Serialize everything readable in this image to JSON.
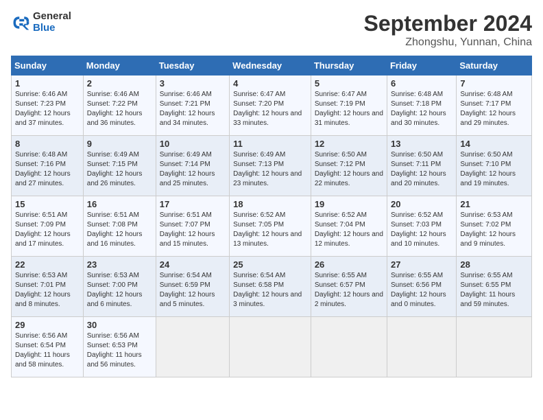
{
  "logo": {
    "general": "General",
    "blue": "Blue"
  },
  "title": "September 2024",
  "location": "Zhongshu, Yunnan, China",
  "days_header": [
    "Sunday",
    "Monday",
    "Tuesday",
    "Wednesday",
    "Thursday",
    "Friday",
    "Saturday"
  ],
  "weeks": [
    [
      {
        "day": "1",
        "sunrise": "6:46 AM",
        "sunset": "7:23 PM",
        "daylight": "12 hours and 37 minutes."
      },
      {
        "day": "2",
        "sunrise": "6:46 AM",
        "sunset": "7:22 PM",
        "daylight": "12 hours and 36 minutes."
      },
      {
        "day": "3",
        "sunrise": "6:46 AM",
        "sunset": "7:21 PM",
        "daylight": "12 hours and 34 minutes."
      },
      {
        "day": "4",
        "sunrise": "6:47 AM",
        "sunset": "7:20 PM",
        "daylight": "12 hours and 33 minutes."
      },
      {
        "day": "5",
        "sunrise": "6:47 AM",
        "sunset": "7:19 PM",
        "daylight": "12 hours and 31 minutes."
      },
      {
        "day": "6",
        "sunrise": "6:48 AM",
        "sunset": "7:18 PM",
        "daylight": "12 hours and 30 minutes."
      },
      {
        "day": "7",
        "sunrise": "6:48 AM",
        "sunset": "7:17 PM",
        "daylight": "12 hours and 29 minutes."
      }
    ],
    [
      {
        "day": "8",
        "sunrise": "6:48 AM",
        "sunset": "7:16 PM",
        "daylight": "12 hours and 27 minutes."
      },
      {
        "day": "9",
        "sunrise": "6:49 AM",
        "sunset": "7:15 PM",
        "daylight": "12 hours and 26 minutes."
      },
      {
        "day": "10",
        "sunrise": "6:49 AM",
        "sunset": "7:14 PM",
        "daylight": "12 hours and 25 minutes."
      },
      {
        "day": "11",
        "sunrise": "6:49 AM",
        "sunset": "7:13 PM",
        "daylight": "12 hours and 23 minutes."
      },
      {
        "day": "12",
        "sunrise": "6:50 AM",
        "sunset": "7:12 PM",
        "daylight": "12 hours and 22 minutes."
      },
      {
        "day": "13",
        "sunrise": "6:50 AM",
        "sunset": "7:11 PM",
        "daylight": "12 hours and 20 minutes."
      },
      {
        "day": "14",
        "sunrise": "6:50 AM",
        "sunset": "7:10 PM",
        "daylight": "12 hours and 19 minutes."
      }
    ],
    [
      {
        "day": "15",
        "sunrise": "6:51 AM",
        "sunset": "7:09 PM",
        "daylight": "12 hours and 17 minutes."
      },
      {
        "day": "16",
        "sunrise": "6:51 AM",
        "sunset": "7:08 PM",
        "daylight": "12 hours and 16 minutes."
      },
      {
        "day": "17",
        "sunrise": "6:51 AM",
        "sunset": "7:07 PM",
        "daylight": "12 hours and 15 minutes."
      },
      {
        "day": "18",
        "sunrise": "6:52 AM",
        "sunset": "7:05 PM",
        "daylight": "12 hours and 13 minutes."
      },
      {
        "day": "19",
        "sunrise": "6:52 AM",
        "sunset": "7:04 PM",
        "daylight": "12 hours and 12 minutes."
      },
      {
        "day": "20",
        "sunrise": "6:52 AM",
        "sunset": "7:03 PM",
        "daylight": "12 hours and 10 minutes."
      },
      {
        "day": "21",
        "sunrise": "6:53 AM",
        "sunset": "7:02 PM",
        "daylight": "12 hours and 9 minutes."
      }
    ],
    [
      {
        "day": "22",
        "sunrise": "6:53 AM",
        "sunset": "7:01 PM",
        "daylight": "12 hours and 8 minutes."
      },
      {
        "day": "23",
        "sunrise": "6:53 AM",
        "sunset": "7:00 PM",
        "daylight": "12 hours and 6 minutes."
      },
      {
        "day": "24",
        "sunrise": "6:54 AM",
        "sunset": "6:59 PM",
        "daylight": "12 hours and 5 minutes."
      },
      {
        "day": "25",
        "sunrise": "6:54 AM",
        "sunset": "6:58 PM",
        "daylight": "12 hours and 3 minutes."
      },
      {
        "day": "26",
        "sunrise": "6:55 AM",
        "sunset": "6:57 PM",
        "daylight": "12 hours and 2 minutes."
      },
      {
        "day": "27",
        "sunrise": "6:55 AM",
        "sunset": "6:56 PM",
        "daylight": "12 hours and 0 minutes."
      },
      {
        "day": "28",
        "sunrise": "6:55 AM",
        "sunset": "6:55 PM",
        "daylight": "11 hours and 59 minutes."
      }
    ],
    [
      {
        "day": "29",
        "sunrise": "6:56 AM",
        "sunset": "6:54 PM",
        "daylight": "11 hours and 58 minutes."
      },
      {
        "day": "30",
        "sunrise": "6:56 AM",
        "sunset": "6:53 PM",
        "daylight": "11 hours and 56 minutes."
      },
      null,
      null,
      null,
      null,
      null
    ]
  ]
}
